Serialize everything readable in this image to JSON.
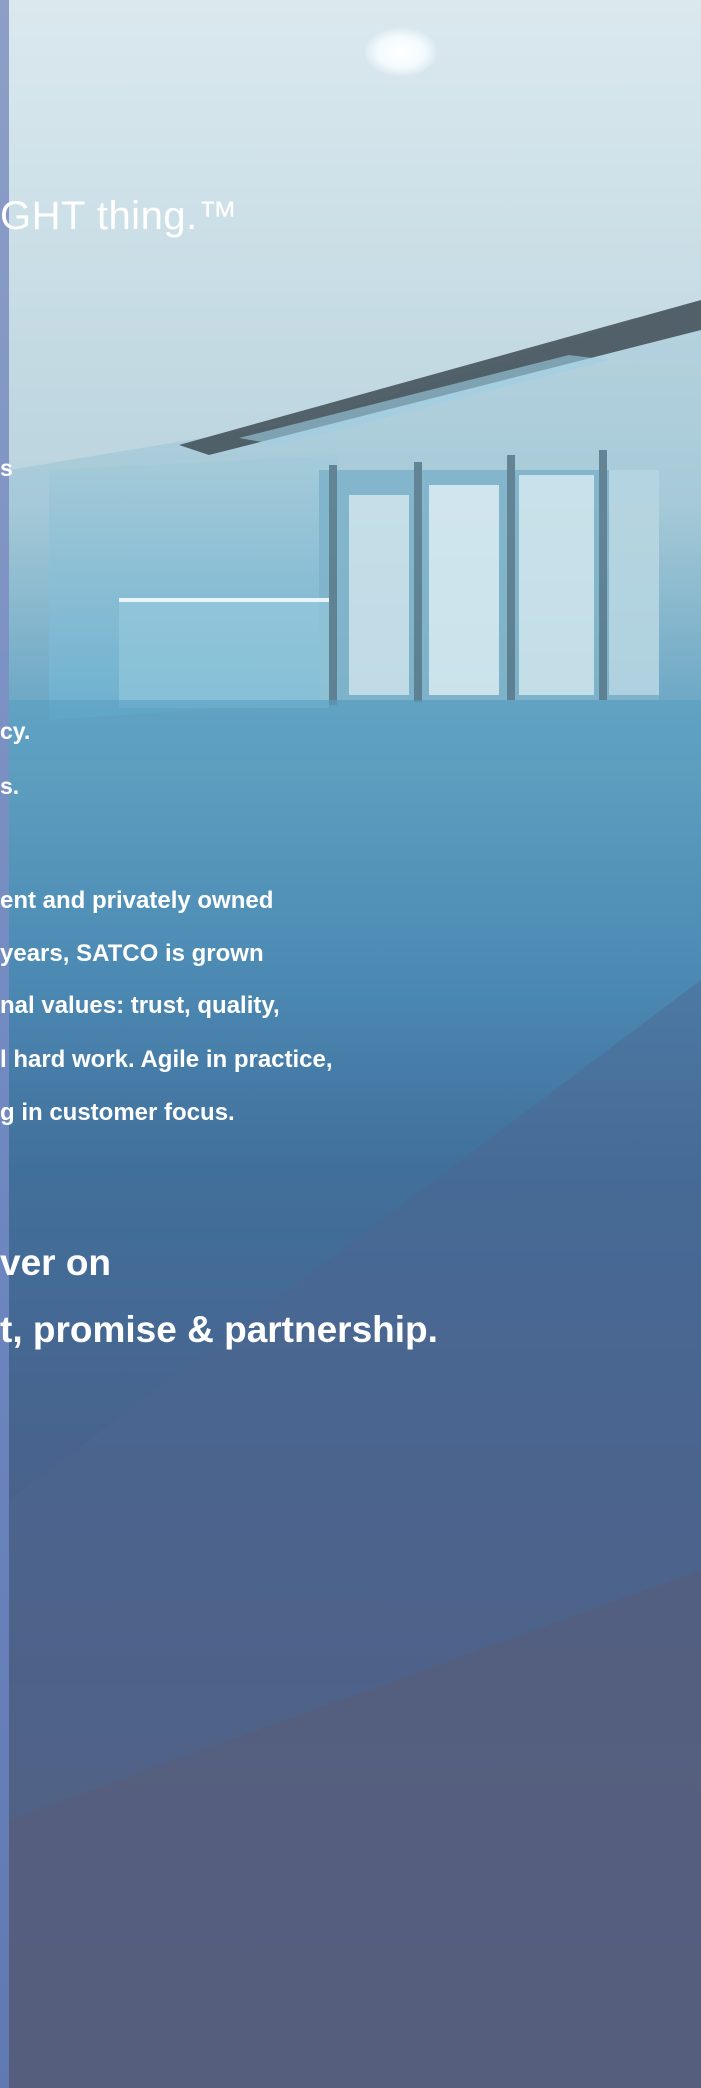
{
  "tagline": "GHT thing.™",
  "frag_s": "s",
  "frag_cy": "cy.",
  "frag_s2": "s.",
  "body_lines": [
    "ent and privately owned",
    " years, SATCO is grown",
    "nal values: trust, quality,",
    "l hard work. Agile in practice,",
    "g in customer focus."
  ],
  "closing_lines": [
    "ver on",
    "t, promise & partnership."
  ],
  "colors": {
    "text": "#ffffff",
    "edge_strip": "#7e93c4",
    "ceiling": "#e3eef3",
    "lobby_blue": "#4f8fb8",
    "floor": "#566083"
  }
}
